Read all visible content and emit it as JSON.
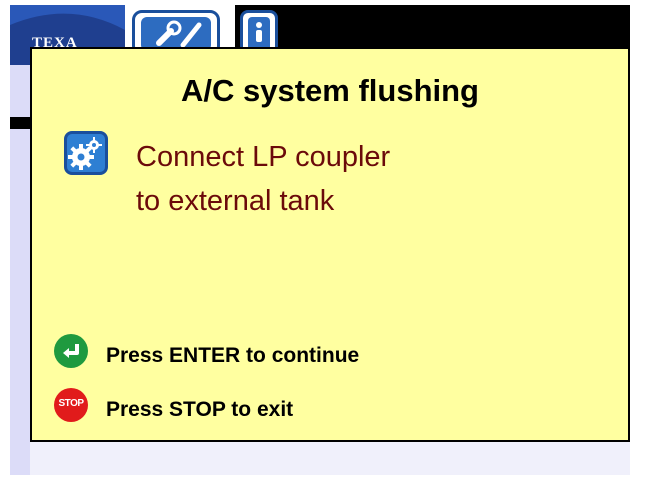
{
  "brand": {
    "logo_text": "TEXA"
  },
  "dialog": {
    "title": "A/C system flushing",
    "message_line1": "Connect LP coupler",
    "message_line2": "to external tank",
    "enter_hint": "Press ENTER to continue",
    "stop_hint": "Press STOP to exit",
    "stop_key_label": "STOP"
  },
  "colors": {
    "dialog_bg": "#ffffa0",
    "message_text": "#6b0a0a",
    "enter_button": "#1f9a3f",
    "stop_button": "#e11b1b",
    "accent_blue": "#1a4f9c"
  },
  "icons": {
    "tools": "wrench-screwdriver-icon",
    "info": "person-info-icon",
    "settings": "gears-icon",
    "enter": "enter-arrow-icon",
    "stop": "stop-icon"
  }
}
